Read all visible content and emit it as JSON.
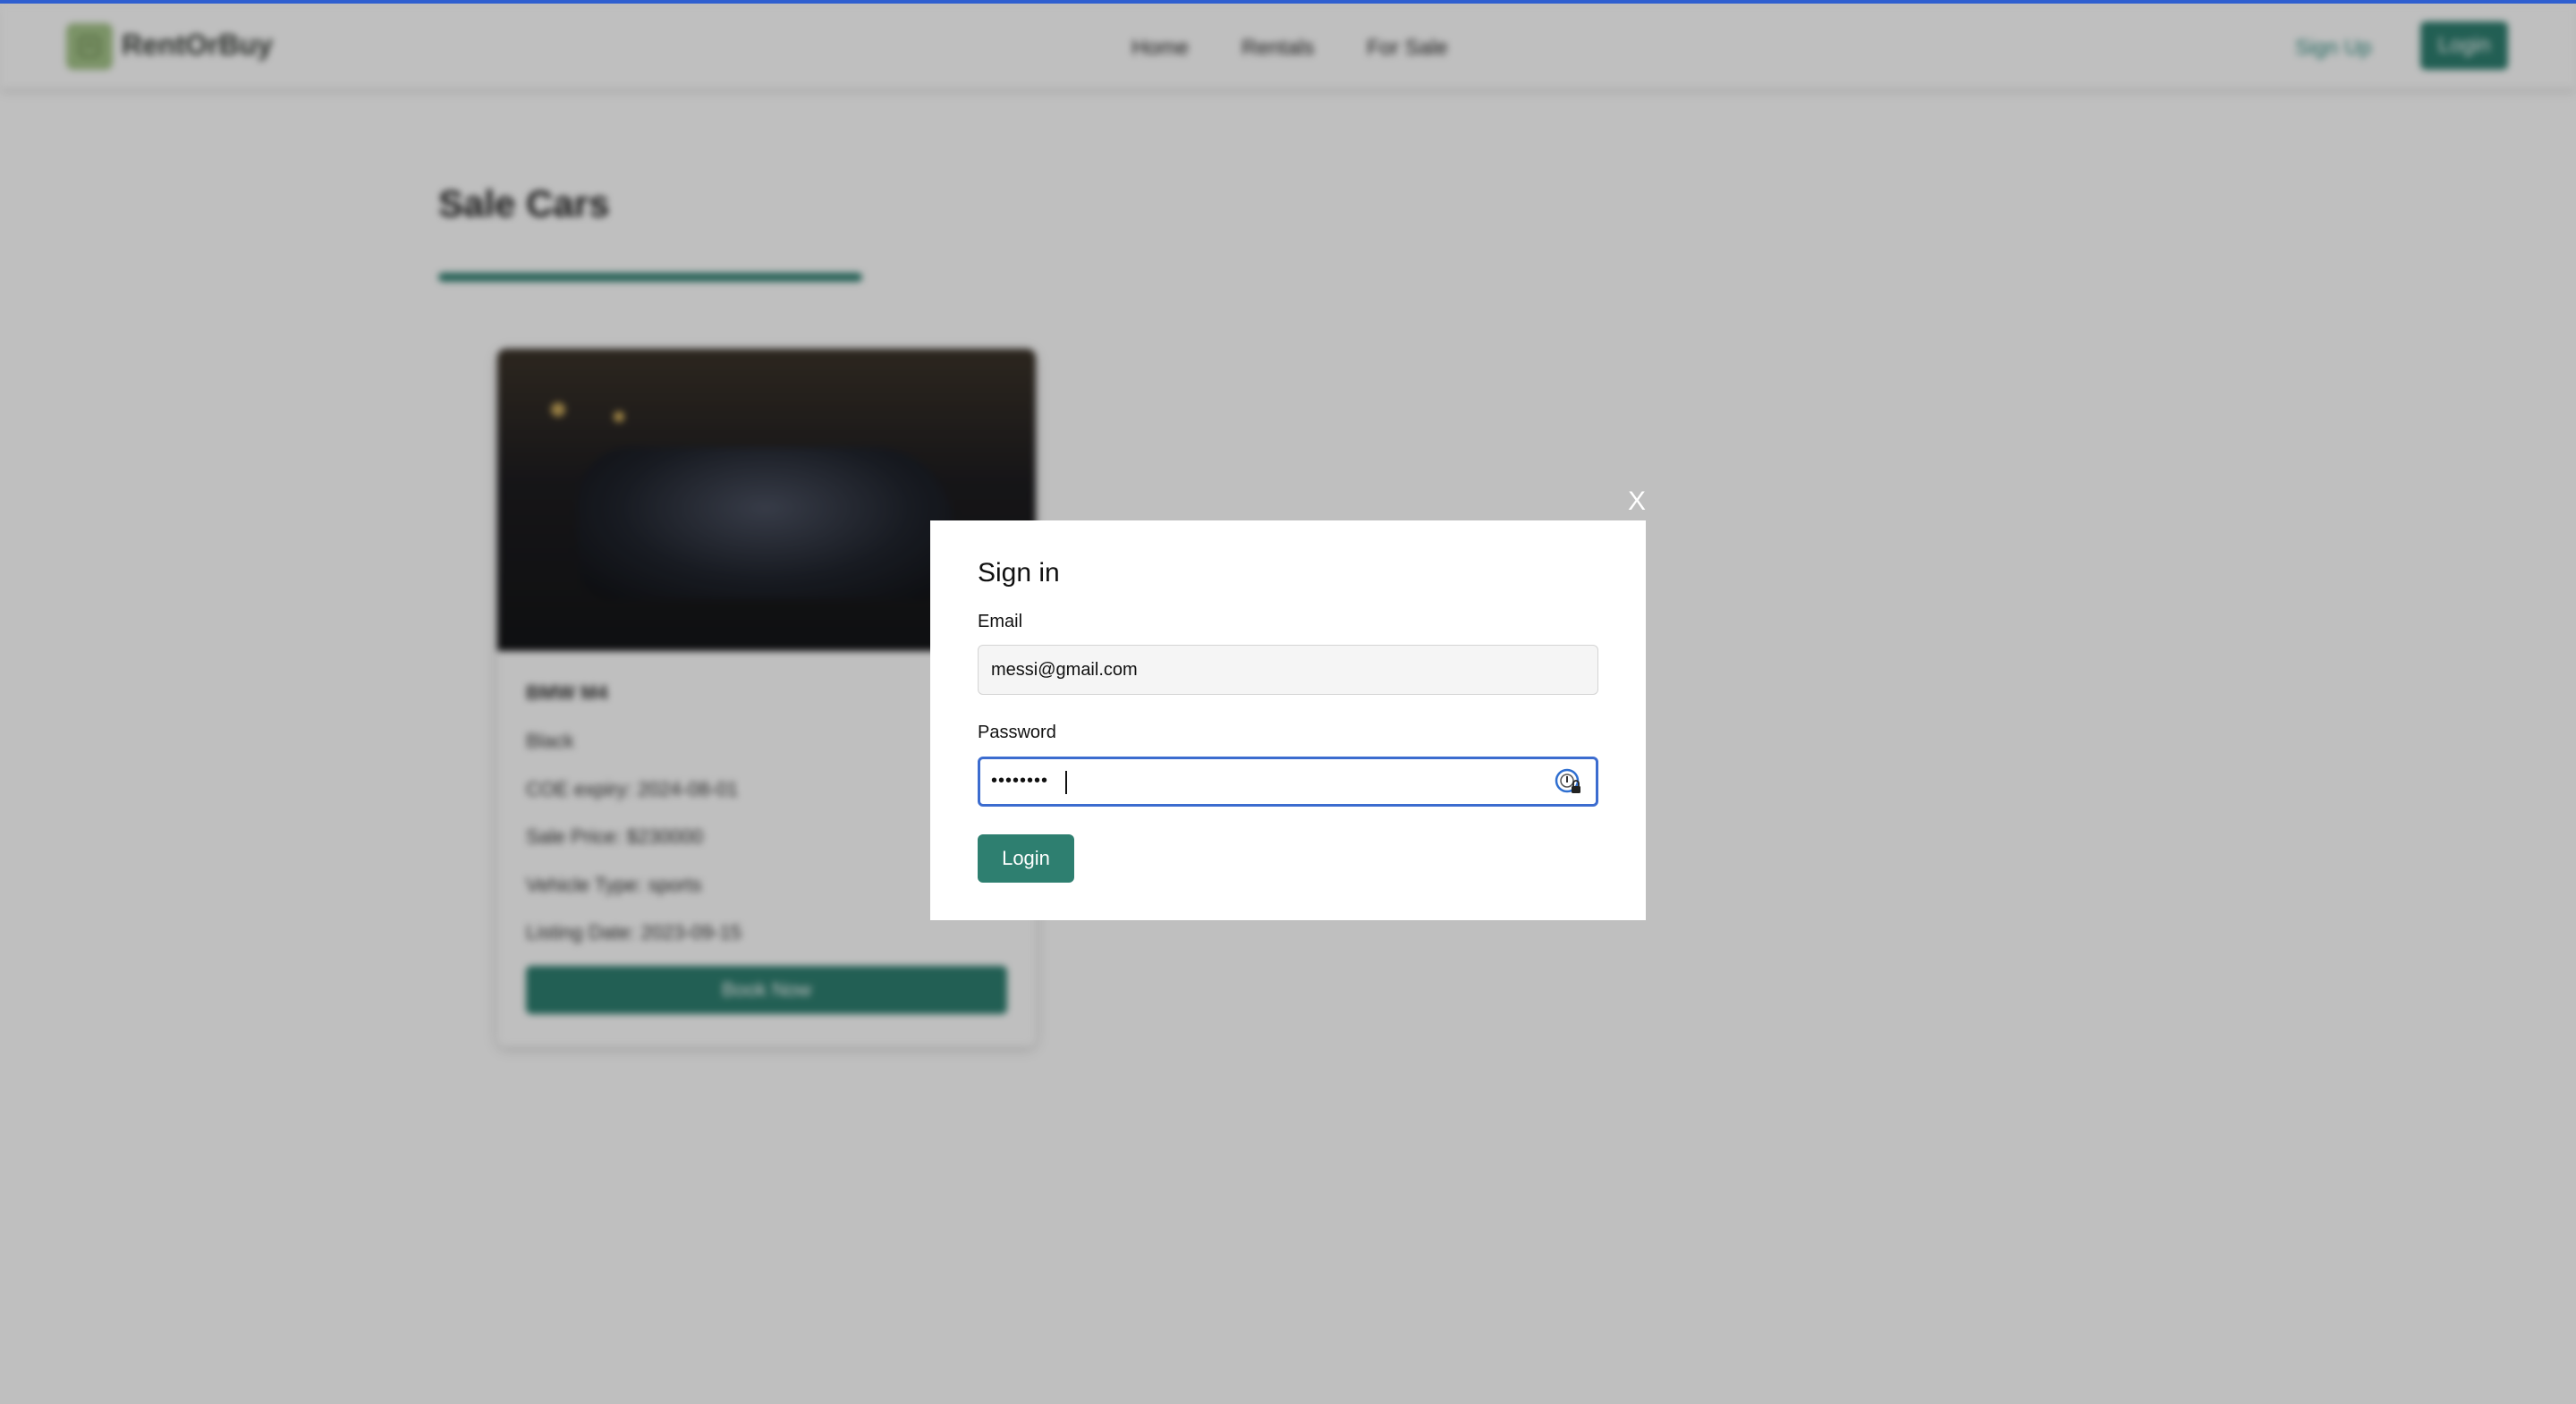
{
  "colors": {
    "accent": "#2e7f70",
    "logo_bg": "#a5c58a",
    "focus_border": "#3c6ccf",
    "top_line": "#2f5fd0"
  },
  "navbar": {
    "brand": "RentOrBuy",
    "links": [
      "Home",
      "Rentals",
      "For Sale"
    ],
    "signup_label": "Sign Up",
    "login_label": "Login"
  },
  "page": {
    "section_title": "Sale Cars"
  },
  "car": {
    "name": "BMW M4",
    "color": "Black",
    "coe_expiry": "COE expiry: 2024-08-01",
    "sale_price": "Sale Price: $230000",
    "vehicle_type": "Vehicle Type: sports",
    "listing_date": "Listing Date: 2023-09-15",
    "book_label": "Book Now"
  },
  "modal": {
    "close_label": "X",
    "title": "Sign in",
    "email_label": "Email",
    "email_value": "messi@gmail.com",
    "password_label": "Password",
    "password_display": "••••••••",
    "submit_label": "Login",
    "password_manager_icon": "password-manager-icon"
  }
}
